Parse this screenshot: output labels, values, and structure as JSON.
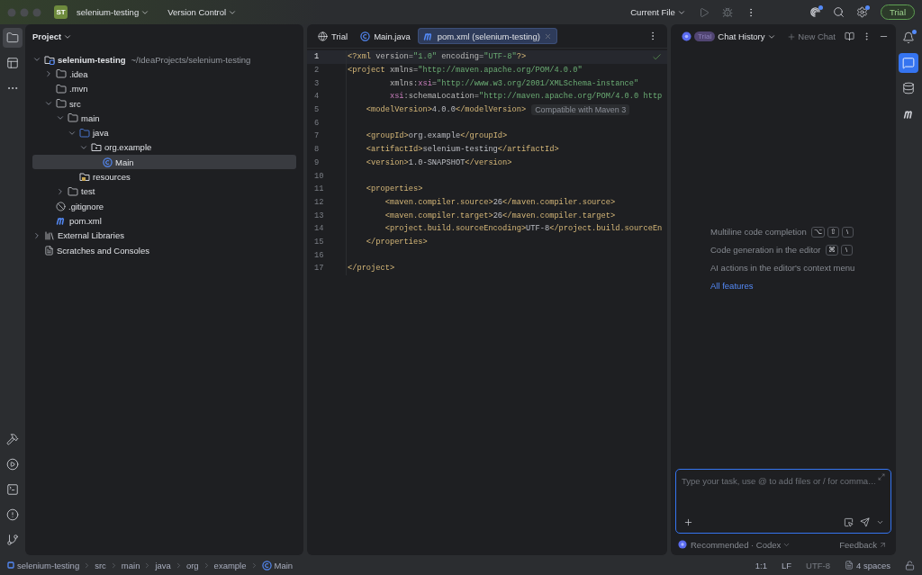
{
  "title_bar": {
    "project_badge": "ST",
    "project": "selenium-testing",
    "vcs": "Version Control",
    "run_config": "Current File",
    "trial": "Trial"
  },
  "left_toolbar": {
    "top": [
      {
        "kind": "project",
        "selected": true
      },
      {
        "kind": "structure",
        "selected": false
      },
      {
        "kind": "more",
        "selected": false
      }
    ],
    "bottom": [
      {
        "kind": "build",
        "selected": false
      },
      {
        "kind": "run",
        "selected": false
      },
      {
        "kind": "terminal",
        "selected": false
      },
      {
        "kind": "problems",
        "selected": false
      },
      {
        "kind": "git",
        "selected": false
      }
    ]
  },
  "project_panel": {
    "title": "Project",
    "tree": [
      {
        "name": "selenium-testing",
        "path": "~/IdeaProjects/selenium-testing",
        "kind": "module",
        "expanded": true,
        "selected": false,
        "children": [
          {
            "name": ".idea",
            "kind": "folder",
            "expanded": false,
            "selected": false
          },
          {
            "name": ".mvn",
            "kind": "folder",
            "selected": false
          },
          {
            "name": "src",
            "kind": "folder",
            "expanded": true,
            "selected": false,
            "children": [
              {
                "name": "main",
                "kind": "folder",
                "expanded": true,
                "selected": false,
                "children": [
                  {
                    "name": "java",
                    "kind": "source",
                    "expanded": true,
                    "selected": false,
                    "children": [
                      {
                        "name": "org.example",
                        "kind": "package",
                        "expanded": true,
                        "selected": false,
                        "children": [
                          {
                            "name": "Main",
                            "kind": "class",
                            "selected": true
                          }
                        ]
                      }
                    ]
                  },
                  {
                    "name": "resources",
                    "kind": "resources",
                    "selected": false
                  }
                ]
              },
              {
                "name": "test",
                "kind": "folder",
                "expanded": false,
                "selected": false
              }
            ]
          },
          {
            "name": ".gitignore",
            "kind": "ignore",
            "selected": false
          },
          {
            "name": "pom.xml",
            "kind": "maven",
            "selected": false
          }
        ]
      },
      {
        "name": "External Libraries",
        "kind": "libraries",
        "expanded": false,
        "selected": false
      },
      {
        "name": "Scratches and Consoles",
        "kind": "scratches",
        "selected": false
      }
    ]
  },
  "editor": {
    "tabs": [
      {
        "label": "Trial",
        "kind": "web",
        "selected": false
      },
      {
        "label": "Main.java",
        "kind": "class",
        "selected": false
      },
      {
        "label": "pom.xml (selenium-testing)",
        "kind": "maven",
        "selected": true
      }
    ],
    "lines": [
      {
        "number": "1",
        "current": true,
        "tokens": [
          {
            "kind": "tag",
            "text": "<?xml"
          },
          {
            "kind": "attr",
            "text": " version="
          },
          {
            "kind": "str",
            "text": "\"1.0\""
          },
          {
            "kind": "attr",
            "text": " encoding="
          },
          {
            "kind": "str",
            "text": "\"UTF-8\""
          },
          {
            "kind": "tag",
            "text": "?>"
          }
        ]
      },
      {
        "number": "2",
        "current": false,
        "tokens": [
          {
            "kind": "tag",
            "text": "<project"
          },
          {
            "kind": "attr",
            "text": " xmlns="
          },
          {
            "kind": "str",
            "text": "\"http://maven.apache.org/POM/4.0.0\""
          }
        ]
      },
      {
        "number": "3",
        "current": false,
        "tokens": [
          {
            "kind": "attr",
            "text": "         xmlns:"
          },
          {
            "kind": "ns",
            "text": "xsi"
          },
          {
            "kind": "attr",
            "text": "="
          },
          {
            "kind": "str",
            "text": "\"http://www.w3.org/2001/XMLSchema-instance\""
          }
        ]
      },
      {
        "number": "4",
        "current": false,
        "tokens": [
          {
            "kind": "ns",
            "text": "         xsi"
          },
          {
            "kind": "attr",
            "text": ":schemaLocation="
          },
          {
            "kind": "str",
            "text": "\"http://maven.apache.org/POM/4.0.0 http"
          }
        ]
      },
      {
        "number": "5",
        "current": false,
        "tokens": [
          {
            "kind": "tag",
            "text": "    <modelVersion>"
          },
          {
            "kind": "text",
            "text": "4.0.0"
          },
          {
            "kind": "tag",
            "text": "</modelVersion>"
          }
        ],
        "hint": "Compatible with Maven 3"
      },
      {
        "number": "6",
        "current": false
      },
      {
        "number": "7",
        "current": false,
        "tokens": [
          {
            "kind": "tag",
            "text": "    <groupId>"
          },
          {
            "kind": "text",
            "text": "org.example"
          },
          {
            "kind": "tag",
            "text": "</groupId>"
          }
        ]
      },
      {
        "number": "8",
        "current": false,
        "tokens": [
          {
            "kind": "tag",
            "text": "    <artifactId>"
          },
          {
            "kind": "text",
            "text": "selenium-testing"
          },
          {
            "kind": "tag",
            "text": "</artifactId>"
          }
        ]
      },
      {
        "number": "9",
        "current": false,
        "tokens": [
          {
            "kind": "tag",
            "text": "    <version>"
          },
          {
            "kind": "text",
            "text": "1.0-SNAPSHOT"
          },
          {
            "kind": "tag",
            "text": "</version>"
          }
        ]
      },
      {
        "number": "10",
        "current": false
      },
      {
        "number": "11",
        "current": false,
        "tokens": [
          {
            "kind": "tag",
            "text": "    <properties>"
          }
        ]
      },
      {
        "number": "12",
        "current": false,
        "tokens": [
          {
            "kind": "tag",
            "text": "        <maven.compiler.source>"
          },
          {
            "kind": "text",
            "text": "26"
          },
          {
            "kind": "tag",
            "text": "</maven.compiler.source>"
          }
        ]
      },
      {
        "number": "13",
        "current": false,
        "tokens": [
          {
            "kind": "tag",
            "text": "        <maven.compiler.target>"
          },
          {
            "kind": "text",
            "text": "26"
          },
          {
            "kind": "tag",
            "text": "</maven.compiler.target>"
          }
        ]
      },
      {
        "number": "14",
        "current": false,
        "tokens": [
          {
            "kind": "tag",
            "text": "        <project.build.sourceEncoding>"
          },
          {
            "kind": "text",
            "text": "UTF-8"
          },
          {
            "kind": "tag",
            "text": "</project.build.sourceEn"
          }
        ]
      },
      {
        "number": "15",
        "current": false,
        "tokens": [
          {
            "kind": "tag",
            "text": "    </properties>"
          }
        ]
      },
      {
        "number": "16",
        "current": false
      },
      {
        "number": "17",
        "current": false,
        "tokens": [
          {
            "kind": "tag",
            "text": "</project>"
          }
        ]
      }
    ]
  },
  "chat_panel": {
    "badge": "Trial",
    "title": "Chat History",
    "new_chat": "New Chat",
    "hints": [
      {
        "text": "Multiline code completion",
        "keys": [
          "⌥",
          "⇧",
          "\\"
        ]
      },
      {
        "text": "Code generation in the editor",
        "keys": [
          "⌘",
          "\\"
        ]
      },
      {
        "text": "AI actions in the editor's context menu"
      }
    ],
    "link": "All features",
    "placeholder": "Type your task, use @ to add files or / for comma…",
    "model": "Recommended · Codex",
    "feedback": "Feedback"
  },
  "right_toolbar": [
    {
      "kind": "notifications",
      "selected": false
    },
    {
      "kind": "ai-chat",
      "selected": true
    },
    {
      "kind": "database",
      "selected": false
    },
    {
      "kind": "maven",
      "selected": false
    }
  ],
  "status_bar": {
    "breadcrumbs": [
      {
        "label": "selenium-testing",
        "kind": "module"
      },
      {
        "label": "src",
        "kind": "folder"
      },
      {
        "label": "main",
        "kind": "folder"
      },
      {
        "label": "java",
        "kind": "folder"
      },
      {
        "label": "org",
        "kind": "folder"
      },
      {
        "label": "example",
        "kind": "folder"
      },
      {
        "label": "Main",
        "kind": "class"
      }
    ],
    "position": "1:1",
    "line_separator": "LF",
    "encoding": "UTF-8",
    "indent": "4 spaces"
  }
}
